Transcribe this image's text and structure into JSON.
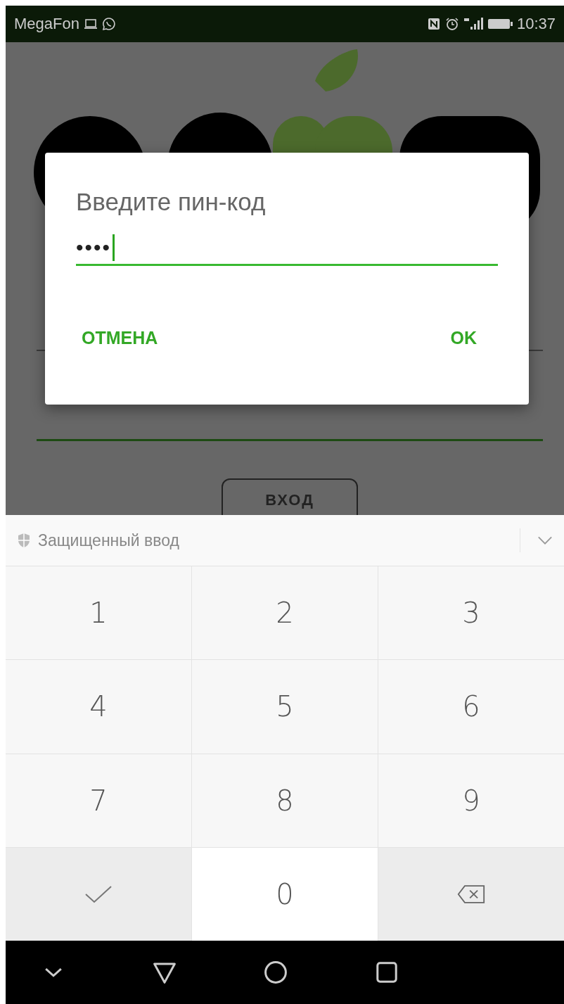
{
  "status_bar": {
    "carrier": "MegaFon",
    "time": "10:37"
  },
  "background": {
    "login_button": "ВХОД"
  },
  "dialog": {
    "title": "Введите пин-код",
    "pin_field": {
      "value": "••••",
      "focused": true
    },
    "buttons": [
      {
        "label": "ОТМЕНА",
        "kind": "cancel"
      },
      {
        "label": "OK",
        "kind": "confirm"
      }
    ]
  },
  "keyboard": {
    "title": "Защищенный ввод",
    "keys": [
      {
        "kind": "digit",
        "label": "1"
      },
      {
        "kind": "digit",
        "label": "2"
      },
      {
        "kind": "digit",
        "label": "3"
      },
      {
        "kind": "digit",
        "label": "4"
      },
      {
        "kind": "digit",
        "label": "5"
      },
      {
        "kind": "digit",
        "label": "6"
      },
      {
        "kind": "digit",
        "label": "7"
      },
      {
        "kind": "digit",
        "label": "8"
      },
      {
        "kind": "digit",
        "label": "9"
      },
      {
        "kind": "done"
      },
      {
        "kind": "digit",
        "label": "0"
      },
      {
        "kind": "backspace"
      }
    ]
  }
}
